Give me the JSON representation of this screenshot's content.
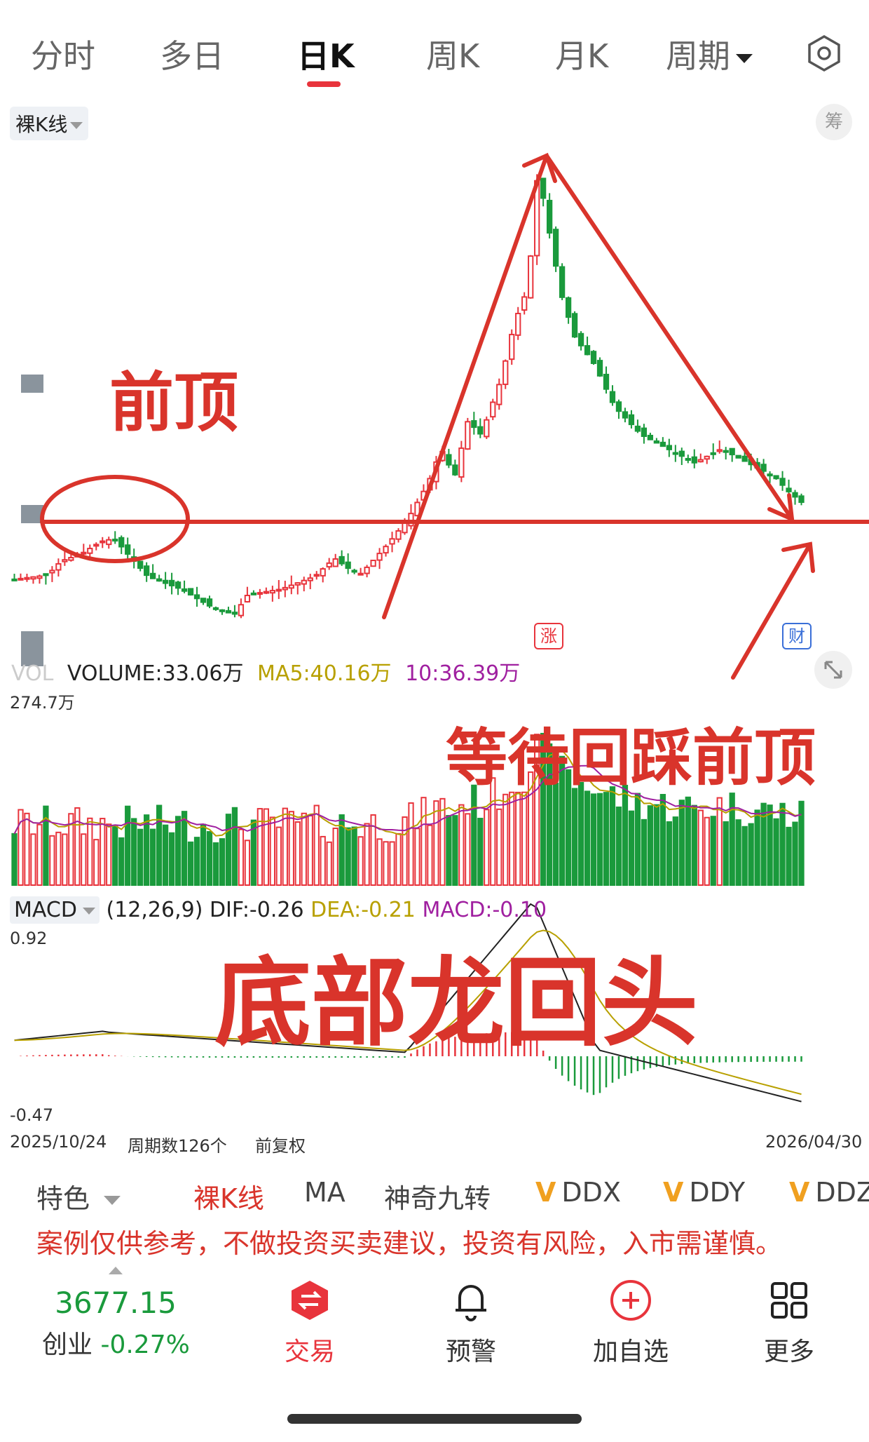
{
  "tabs": [
    {
      "label": "分时",
      "active": false
    },
    {
      "label": "多日",
      "active": false
    },
    {
      "label": "日K",
      "active": true
    },
    {
      "label": "周K",
      "active": false
    },
    {
      "label": "月K",
      "active": false
    },
    {
      "label": "周期",
      "active": false,
      "dropdown": true
    }
  ],
  "chart_header": {
    "mode": "裸K线",
    "chip_right": "筹",
    "markers": {
      "zhang": "涨",
      "cai": "财"
    }
  },
  "volume": {
    "label_prefix": "VOL",
    "volume": "VOLUME:33.06万",
    "ma5": "MA5:40.16万",
    "ma10": "10:36.39万",
    "max_label": "274.7万",
    "colors": {
      "ma5": "#b8a000",
      "ma10": "#a020a0"
    }
  },
  "macd": {
    "mode": "MACD",
    "params": "(12,26,9)",
    "dif": "DIF:-0.26",
    "dea": "DEA:-0.21",
    "macd": "MACD:-0.10",
    "max_label": "0.92",
    "min_label": "-0.47"
  },
  "footer_axis": {
    "start_date": "2025/10/24",
    "period_count": "周期数126个",
    "adjust": "前复权",
    "end_date": "2026/04/30"
  },
  "annotations": {
    "prev_top": "前顶",
    "wait_retest": "等待回踩前顶",
    "bottom_dragon": "底部龙回头"
  },
  "indicator_row": {
    "tese": "特色",
    "items": [
      "裸K线",
      "MA",
      "神奇九转"
    ],
    "v_items": [
      "DDX",
      "DDY",
      "DDZ"
    ]
  },
  "disclaimer": "案例仅供参考，不做投资买卖建议，投资有风险，入市需谨慎。",
  "index": {
    "value": "3677.15",
    "name": "创业",
    "change": "-0.27%",
    "color": "#1a9a3c"
  },
  "nav": [
    {
      "label": "交易",
      "icon": "trade-icon"
    },
    {
      "label": "预警",
      "icon": "bell-icon"
    },
    {
      "label": "加自选",
      "icon": "add-circle-icon"
    },
    {
      "label": "更多",
      "icon": "grid-icon"
    }
  ],
  "colors": {
    "up": "#e8343c",
    "down": "#1a9a3c",
    "accent": "#e8343c",
    "annot": "#d9342b"
  }
}
